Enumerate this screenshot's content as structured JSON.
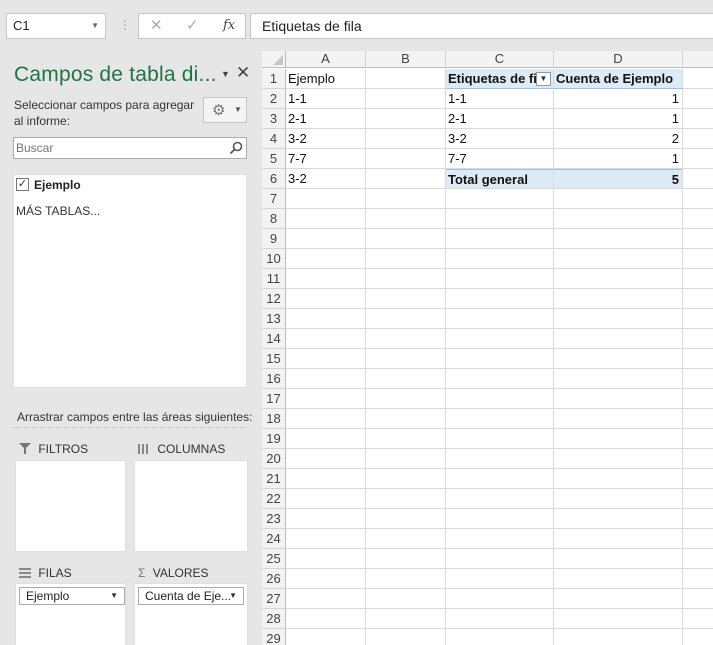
{
  "name_box": {
    "value": "C1"
  },
  "formula_bar": {
    "value": "Etiquetas de fila",
    "cancel_glyph": "✕",
    "enter_glyph": "✓",
    "fx_glyph": "fx"
  },
  "pivot_pane": {
    "title": "Campos de tabla di...",
    "subtitle": "Seleccionar campos para agregar al informe:",
    "search_placeholder": "Buscar",
    "fields": [
      {
        "label": "Ejemplo",
        "checked": true
      }
    ],
    "more_tables": "MÁS TABLAS...",
    "drag_hint": "Arrastrar campos entre las áreas siguientes:",
    "areas": {
      "filters": {
        "label": "FILTROS"
      },
      "columns": {
        "label": "COLUMNAS"
      },
      "rows": {
        "label": "FILAS",
        "chip": "Ejemplo"
      },
      "values": {
        "label": "VALORES",
        "chip": "Cuenta de Eje..."
      }
    },
    "icons": [
      "chevron-down-icon",
      "close-icon",
      "gear-icon",
      "search-icon",
      "filter-icon",
      "columns-icon",
      "rows-icon",
      "sigma-icon"
    ]
  },
  "sheet": {
    "columns": [
      "A",
      "B",
      "C",
      "D"
    ],
    "row_numbers": [
      "1",
      "2",
      "3",
      "4",
      "5",
      "6",
      "7",
      "8",
      "9",
      "10",
      "11",
      "12",
      "13",
      "14",
      "15",
      "16",
      "17",
      "18",
      "19",
      "20",
      "21",
      "22",
      "23",
      "24",
      "25",
      "26",
      "27",
      "28",
      "29"
    ],
    "col_a": [
      "Ejemplo",
      "1-1",
      "2-1",
      "3-2",
      "7-7",
      "3-2"
    ],
    "pivot": {
      "header_labels": "Etiquetas de fi",
      "header_values": "Cuenta de Ejemplo",
      "rows": [
        {
          "label": "1-1",
          "value": "1"
        },
        {
          "label": "2-1",
          "value": "1"
        },
        {
          "label": "3-2",
          "value": "2"
        },
        {
          "label": "7-7",
          "value": "1"
        }
      ],
      "total_label": "Total general",
      "total_value": "5"
    },
    "pivot_header_color": "#ddebf7"
  }
}
